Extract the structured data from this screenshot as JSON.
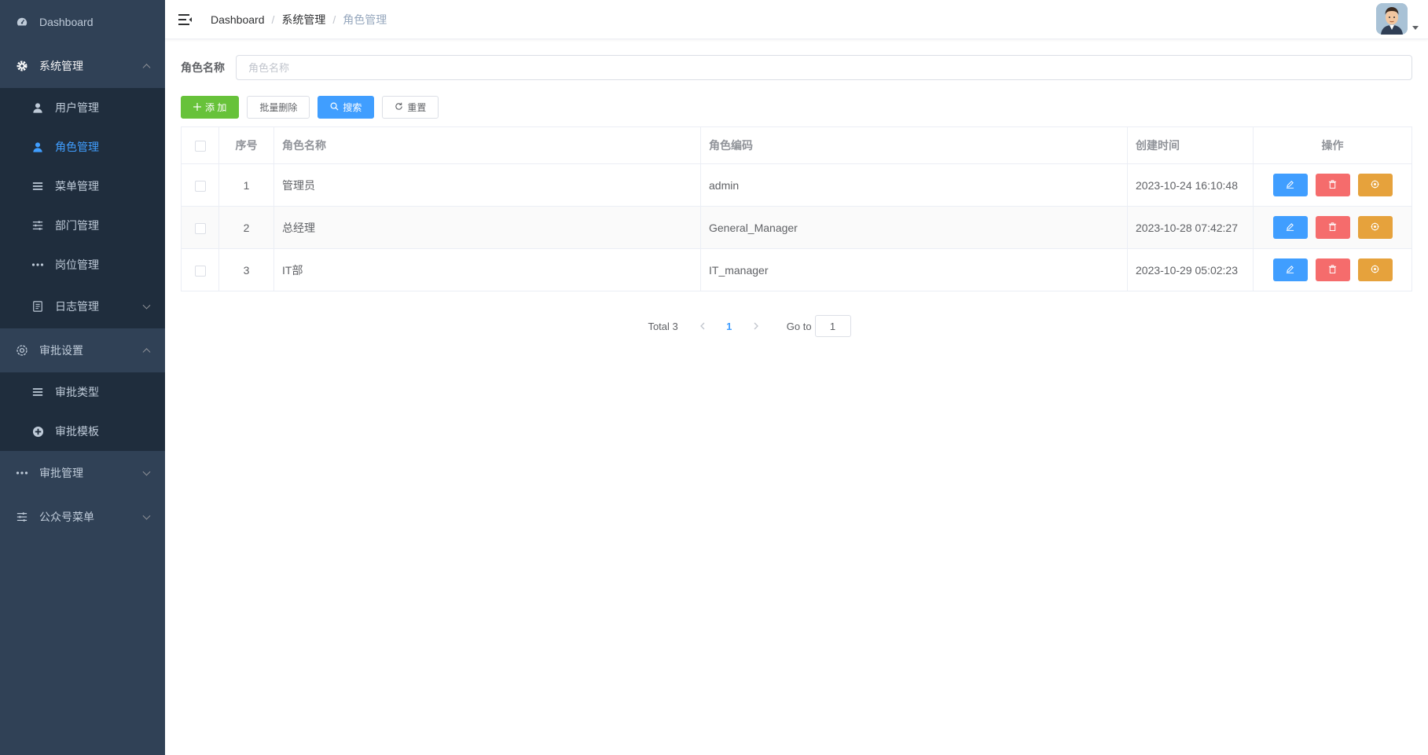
{
  "sidebar": {
    "dashboard": "Dashboard",
    "system": {
      "label": "系统管理",
      "items": [
        {
          "label": "用户管理",
          "icon": "user-icon"
        },
        {
          "label": "角色管理",
          "icon": "user-icon",
          "active": true
        },
        {
          "label": "菜单管理",
          "icon": "list-icon"
        },
        {
          "label": "部门管理",
          "icon": "sliders-icon"
        },
        {
          "label": "岗位管理",
          "icon": "more-icon"
        },
        {
          "label": "日志管理",
          "icon": "document-icon"
        }
      ]
    },
    "approval_settings": {
      "label": "审批设置",
      "items": [
        {
          "label": "审批类型",
          "icon": "list-icon"
        },
        {
          "label": "审批模板",
          "icon": "plus-circle-icon"
        }
      ]
    },
    "approval_manage": "审批管理",
    "wechat_menu": "公众号菜单"
  },
  "breadcrumb": [
    "Dashboard",
    "系统管理",
    "角色管理"
  ],
  "search": {
    "label": "角色名称",
    "placeholder": "角色名称",
    "value": ""
  },
  "toolbar": {
    "add": "添 加",
    "batch_delete": "批量删除",
    "search": "搜索",
    "reset": "重置"
  },
  "table": {
    "headers": {
      "index": "序号",
      "name": "角色名称",
      "code": "角色编码",
      "created": "创建时间",
      "ops": "操作"
    },
    "rows": [
      {
        "index": "1",
        "name": "管理员",
        "code": "admin",
        "created": "2023-10-24 16:10:48"
      },
      {
        "index": "2",
        "name": "总经理",
        "code": "General_Manager",
        "created": "2023-10-28 07:42:27"
      },
      {
        "index": "3",
        "name": "IT部",
        "code": "IT_manager",
        "created": "2023-10-29 05:02:23"
      }
    ]
  },
  "pagination": {
    "total": "Total 3",
    "current": "1",
    "goto_label": "Go to",
    "goto_value": "1"
  },
  "colors": {
    "sidebar_bg": "#304156",
    "submenu_bg": "#1f2d3d",
    "primary": "#409eff",
    "success": "#67c23a",
    "danger": "#f56c6c",
    "warning": "#e6a23c"
  }
}
